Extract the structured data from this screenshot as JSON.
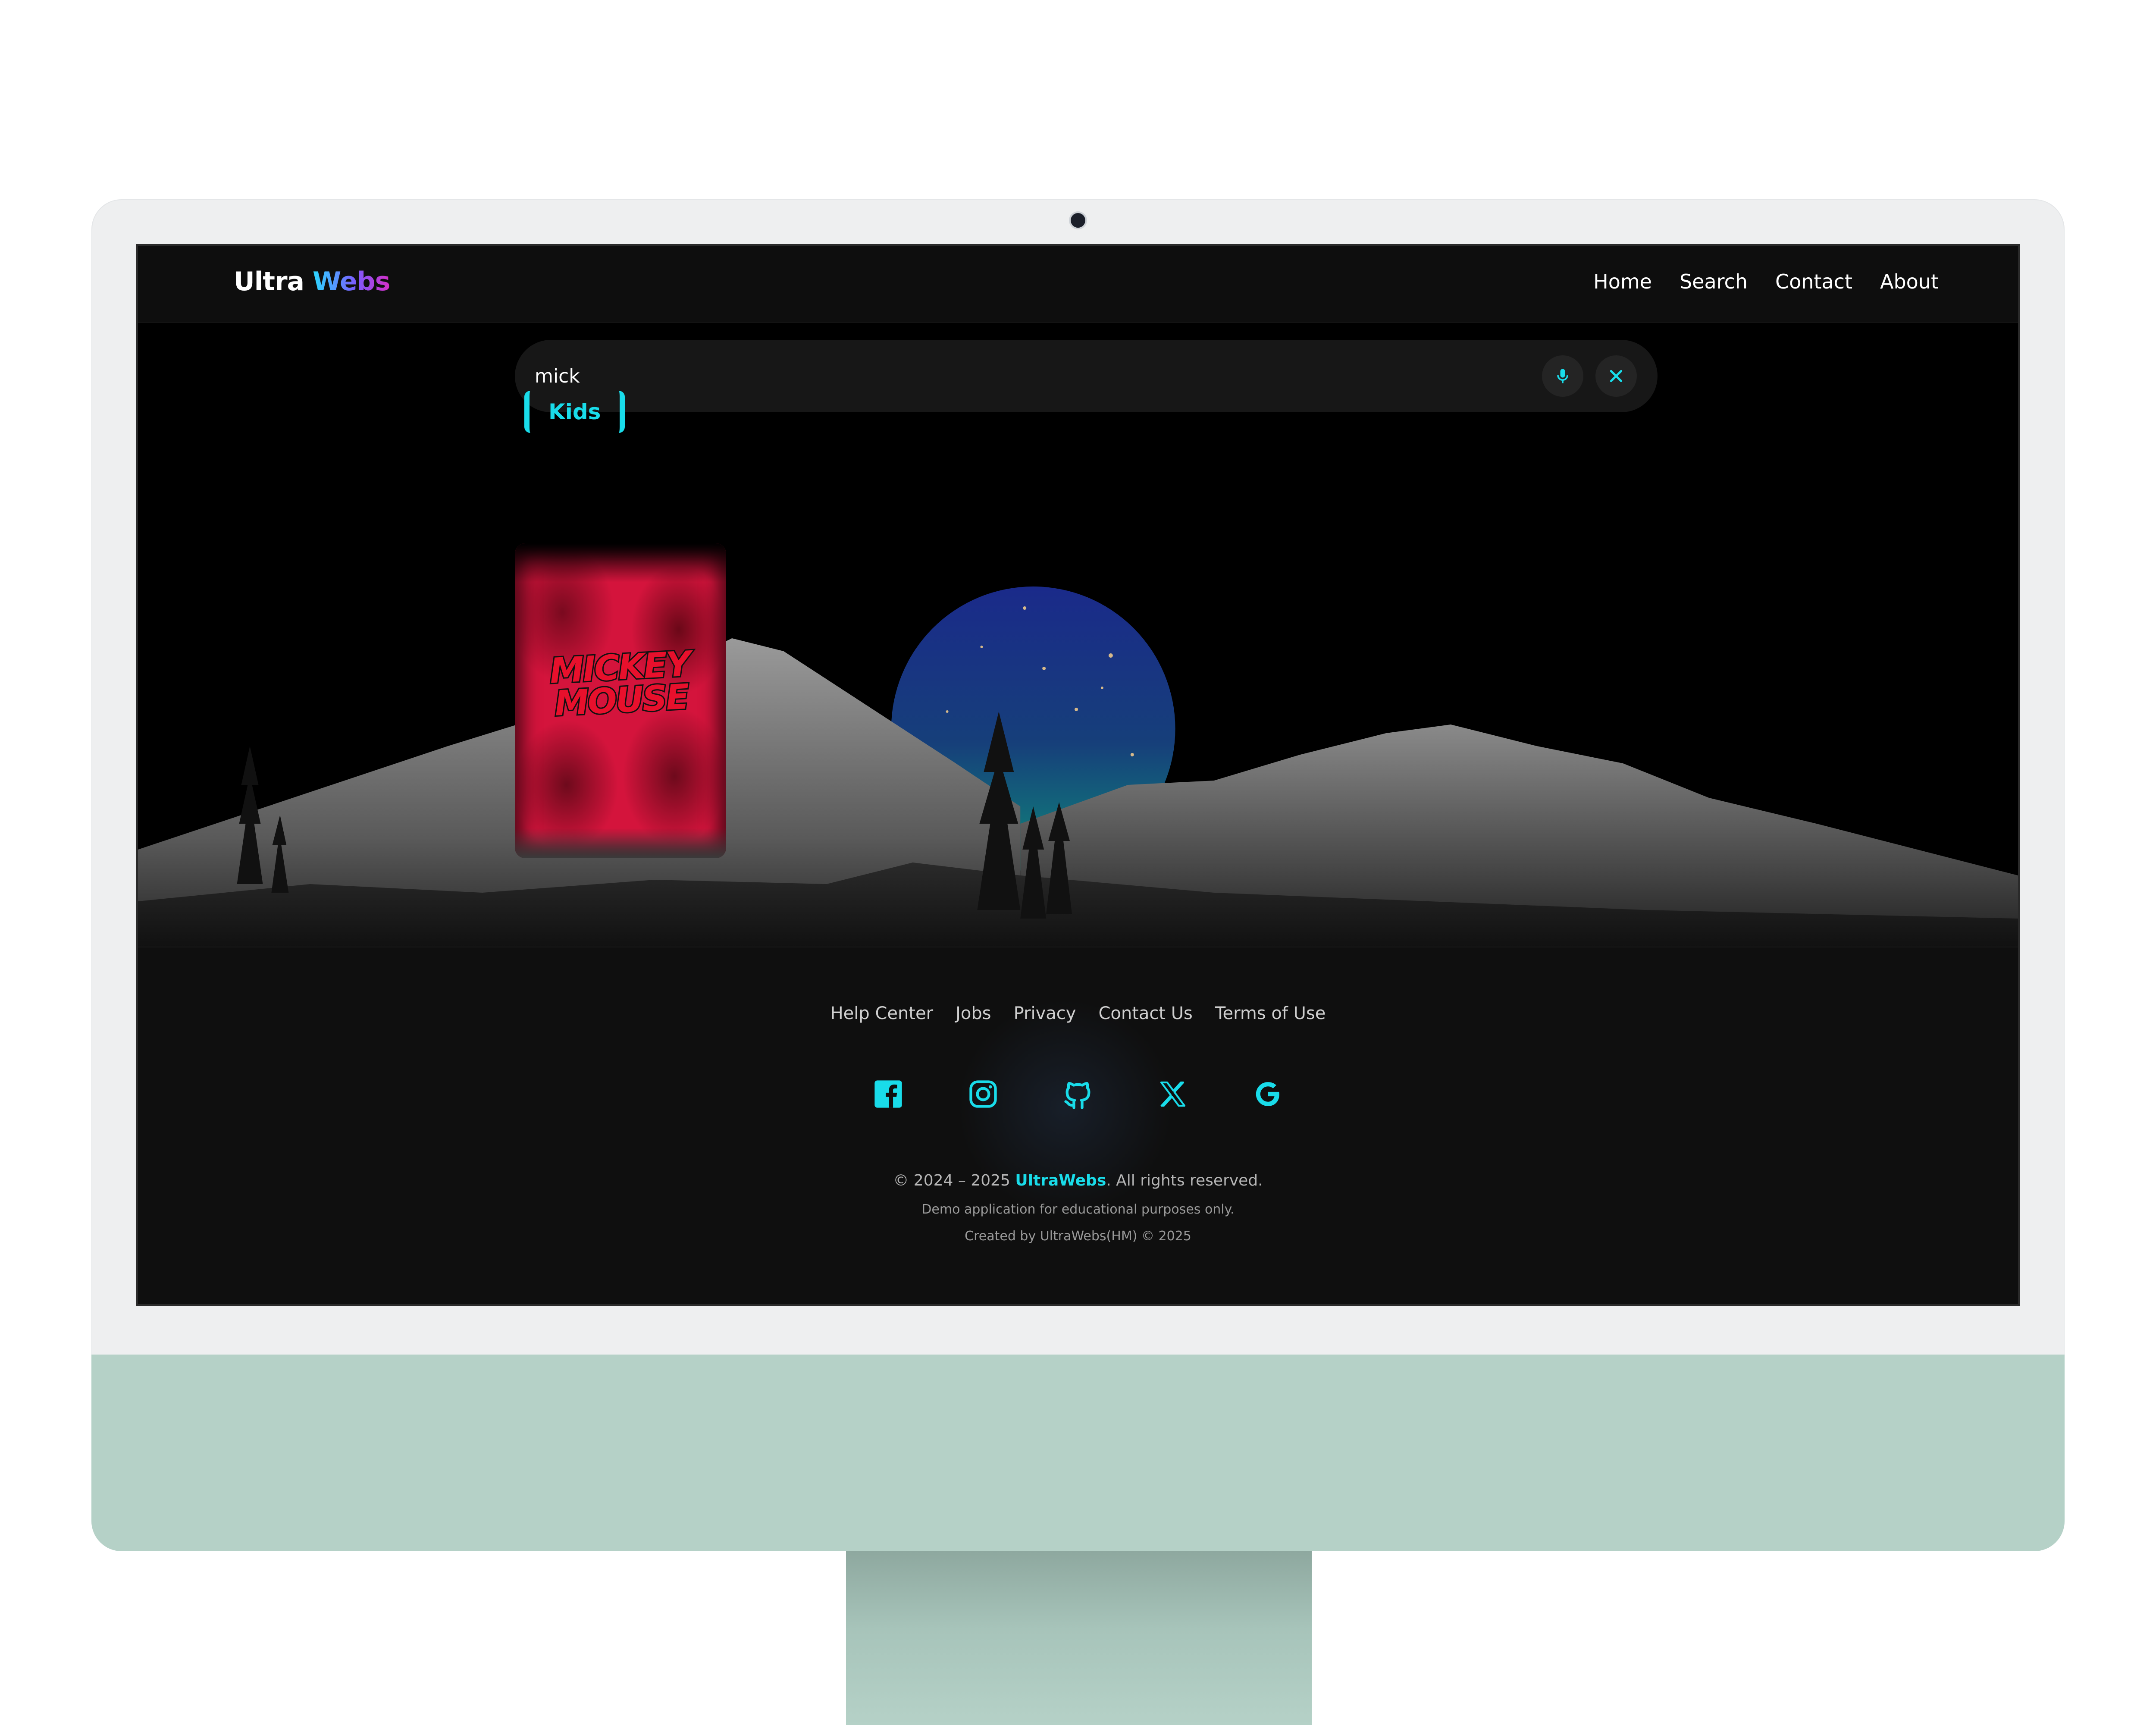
{
  "header": {
    "brand_part1": "Ultra",
    "brand_part2": "Webs",
    "nav": [
      "Home",
      "Search",
      "Contact",
      "About"
    ]
  },
  "search": {
    "value": "mick",
    "mic_icon": "microphone-icon",
    "clear_icon": "close-icon"
  },
  "results": {
    "category": "Kids",
    "cards": [
      {
        "title_line1": "MICKEY",
        "title_line2": "MOUSE"
      }
    ]
  },
  "footer": {
    "links": [
      "Help Center",
      "Jobs",
      "Privacy",
      "Contact Us",
      "Terms of Use"
    ],
    "socials": [
      "facebook-icon",
      "instagram-icon",
      "github-icon",
      "x-icon",
      "google-icon"
    ],
    "copyright_prefix": "© 2024 – 2025",
    "copyright_brand": "UltraWebs",
    "copyright_suffix": ". All rights reserved.",
    "note1": "Demo application for educational purposes only.",
    "note2": "Created by UltraWebs(HM) © 2025"
  },
  "colors": {
    "accent": "#19dcea",
    "monitor_body": "#eeeff0",
    "monitor_chin": "#b5d1c7",
    "card_red": "#d4143c"
  }
}
